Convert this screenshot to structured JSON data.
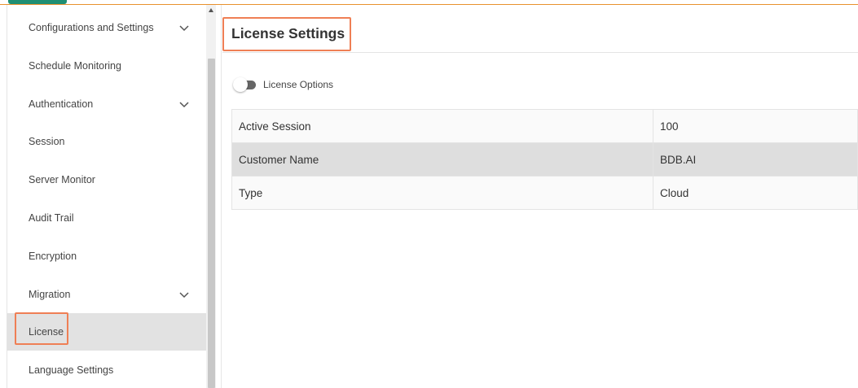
{
  "colors": {
    "accent_orange": "#e8912d",
    "highlight_border": "#ef7f55",
    "logo_green": "#1f8f73",
    "active_row_bg": "#e2e2e2",
    "toggle_track": "#666666"
  },
  "sidebar": {
    "items": [
      {
        "label": "Configurations and Settings",
        "has_chevron": true
      },
      {
        "label": "Schedule Monitoring",
        "has_chevron": false
      },
      {
        "label": "Authentication",
        "has_chevron": true
      },
      {
        "label": "Session",
        "has_chevron": false
      },
      {
        "label": "Server Monitor",
        "has_chevron": false
      },
      {
        "label": "Audit Trail",
        "has_chevron": false
      },
      {
        "label": "Encryption",
        "has_chevron": false
      },
      {
        "label": "Migration",
        "has_chevron": true
      },
      {
        "label": "License",
        "has_chevron": false,
        "active": true
      },
      {
        "label": "Language Settings",
        "has_chevron": false
      }
    ],
    "chevron_icon": "chevron-down-icon"
  },
  "main": {
    "title": "License Settings",
    "license_options": {
      "label": "License Options",
      "enabled": false
    },
    "table": {
      "rows": [
        {
          "key": "Active Session",
          "value": "100"
        },
        {
          "key": "Customer Name",
          "value": "BDB.AI"
        },
        {
          "key": "Type",
          "value": "Cloud"
        }
      ]
    }
  }
}
